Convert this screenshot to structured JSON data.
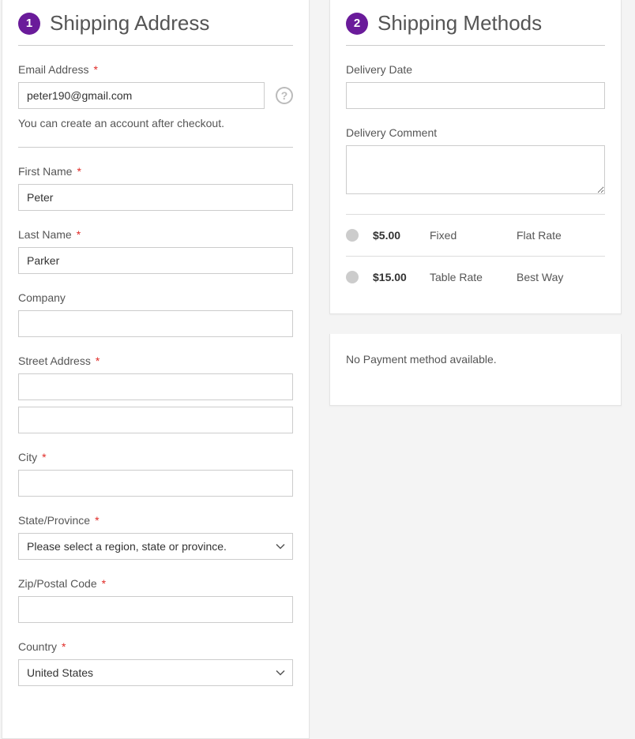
{
  "shipping_address": {
    "step": "1",
    "title": "Shipping Address",
    "email": {
      "label": "Email Address",
      "value": "peter190@gmail.com",
      "hint": "You can create an account after checkout."
    },
    "first_name": {
      "label": "First Name",
      "value": "Peter"
    },
    "last_name": {
      "label": "Last Name",
      "value": "Parker"
    },
    "company": {
      "label": "Company",
      "value": ""
    },
    "street": {
      "label": "Street Address",
      "line1": "",
      "line2": ""
    },
    "city": {
      "label": "City",
      "value": ""
    },
    "region": {
      "label": "State/Province",
      "placeholder": "Please select a region, state or province."
    },
    "zip": {
      "label": "Zip/Postal Code",
      "value": ""
    },
    "country": {
      "label": "Country",
      "value": "United States"
    }
  },
  "shipping_methods": {
    "step": "2",
    "title": "Shipping Methods",
    "delivery_date_label": "Delivery Date",
    "delivery_comment_label": "Delivery Comment",
    "methods": [
      {
        "price": "$5.00",
        "method": "Fixed",
        "carrier": "Flat Rate"
      },
      {
        "price": "$15.00",
        "method": "Table Rate",
        "carrier": "Best Way"
      }
    ]
  },
  "payment": {
    "message": "No Payment method available."
  }
}
